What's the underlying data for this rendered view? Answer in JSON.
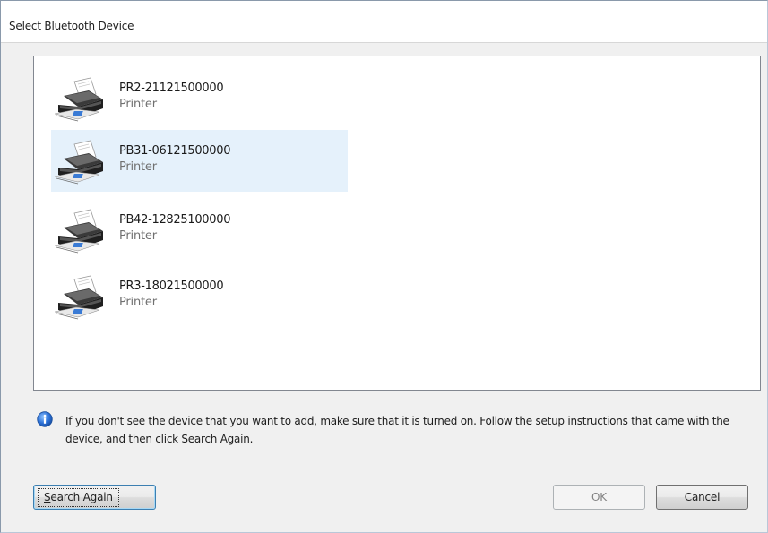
{
  "window": {
    "title": "Select Bluetooth Device"
  },
  "devices": [
    {
      "name": "PR2-21121500000",
      "type": "Printer",
      "selected": false
    },
    {
      "name": "PB31-06121500000",
      "type": "Printer",
      "selected": true
    },
    {
      "name": "PB42-12825100000",
      "type": "Printer",
      "selected": false
    },
    {
      "name": "PR3-18021500000",
      "type": "Printer",
      "selected": false
    }
  ],
  "info": {
    "icon": "info-icon",
    "text": "If you don't see the device that you want to add, make sure that it is turned on. Follow the setup instructions that came with the device, and then click Search Again."
  },
  "buttons": {
    "search_again_rest": "earch Again",
    "search_again_mnemonic": "S",
    "ok": "OK",
    "cancel": "Cancel"
  },
  "colors": {
    "selection": "#e5f1fb",
    "info_icon": "#2a6fd6"
  }
}
